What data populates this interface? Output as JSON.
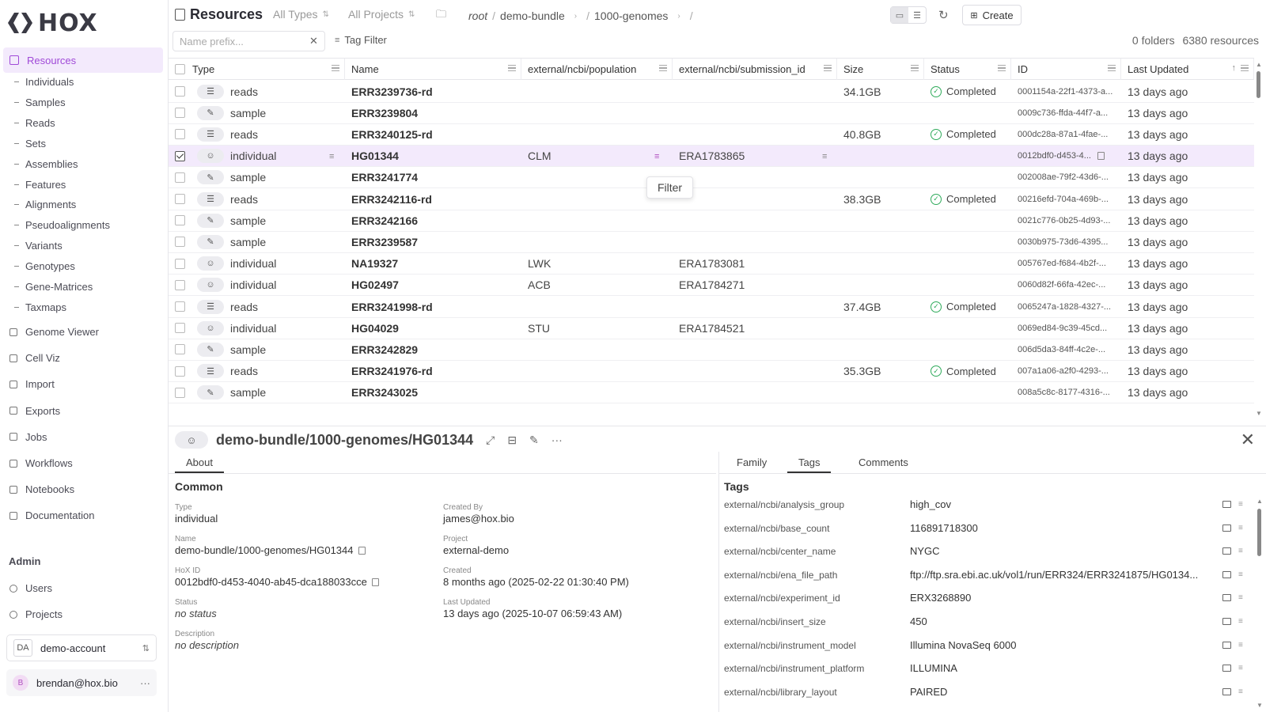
{
  "app": {
    "logo_text": "HOX"
  },
  "sidebar": {
    "active": "Resources",
    "sub_items": [
      "Individuals",
      "Samples",
      "Reads",
      "Sets",
      "Assemblies",
      "Features",
      "Alignments",
      "Pseudoalignments",
      "Variants",
      "Genotypes",
      "Gene-Matrices",
      "Taxmaps"
    ],
    "items": [
      "Genome Viewer",
      "Cell Viz",
      "Import",
      "Exports",
      "Jobs",
      "Workflows",
      "Notebooks",
      "Documentation"
    ],
    "admin_label": "Admin",
    "admin_items": [
      "Users",
      "Projects"
    ],
    "account": {
      "badge": "DA",
      "name": "demo-account"
    },
    "user": {
      "initial": "B",
      "email": "brendan@hox.bio",
      "more": "···"
    }
  },
  "header": {
    "title": "Resources",
    "types_filter": "All Types",
    "projects_filter": "All Projects",
    "breadcrumb": [
      "root",
      "demo-bundle",
      "1000-genomes"
    ],
    "create_label": "Create"
  },
  "filterbar": {
    "name_placeholder": "Name prefix...",
    "tag_filter_label": "Tag Filter",
    "folders_count": "0 folders",
    "resources_count": "6380 resources"
  },
  "table": {
    "columns": [
      "Type",
      "Name",
      "external/ncbi/population",
      "external/ncbi/submission_id",
      "Size",
      "Status",
      "ID",
      "Last Updated"
    ],
    "rows": [
      {
        "type": "reads",
        "name": "ERR3239736-rd",
        "population": "",
        "submission": "",
        "size": "34.1GB",
        "status": "Completed",
        "id": "0001154a-22f1-4373-a...",
        "updated": "13 days ago",
        "selected": false
      },
      {
        "type": "sample",
        "name": "ERR3239804",
        "population": "",
        "submission": "",
        "size": "",
        "status": "",
        "id": "0009c736-ffda-44f7-a...",
        "updated": "13 days ago",
        "selected": false
      },
      {
        "type": "reads",
        "name": "ERR3240125-rd",
        "population": "",
        "submission": "",
        "size": "40.8GB",
        "status": "Completed",
        "id": "000dc28a-87a1-4fae-...",
        "updated": "13 days ago",
        "selected": false
      },
      {
        "type": "individual",
        "name": "HG01344",
        "population": "CLM",
        "submission": "ERA1783865",
        "size": "",
        "status": "",
        "id": "0012bdf0-d453-4...",
        "updated": "13 days ago",
        "selected": true
      },
      {
        "type": "sample",
        "name": "ERR3241774",
        "population": "",
        "submission": "",
        "size": "",
        "status": "",
        "id": "002008ae-79f2-43d6-...",
        "updated": "13 days ago",
        "selected": false
      },
      {
        "type": "reads",
        "name": "ERR3242116-rd",
        "population": "",
        "submission": "",
        "size": "38.3GB",
        "status": "Completed",
        "id": "00216efd-704a-469b-...",
        "updated": "13 days ago",
        "selected": false
      },
      {
        "type": "sample",
        "name": "ERR3242166",
        "population": "",
        "submission": "",
        "size": "",
        "status": "",
        "id": "0021c776-0b25-4d93-...",
        "updated": "13 days ago",
        "selected": false
      },
      {
        "type": "sample",
        "name": "ERR3239587",
        "population": "",
        "submission": "",
        "size": "",
        "status": "",
        "id": "0030b975-73d6-4395...",
        "updated": "13 days ago",
        "selected": false
      },
      {
        "type": "individual",
        "name": "NA19327",
        "population": "LWK",
        "submission": "ERA1783081",
        "size": "",
        "status": "",
        "id": "005767ed-f684-4b2f-...",
        "updated": "13 days ago",
        "selected": false
      },
      {
        "type": "individual",
        "name": "HG02497",
        "population": "ACB",
        "submission": "ERA1784271",
        "size": "",
        "status": "",
        "id": "0060d82f-66fa-42ec-...",
        "updated": "13 days ago",
        "selected": false
      },
      {
        "type": "reads",
        "name": "ERR3241998-rd",
        "population": "",
        "submission": "",
        "size": "37.4GB",
        "status": "Completed",
        "id": "0065247a-1828-4327-...",
        "updated": "13 days ago",
        "selected": false
      },
      {
        "type": "individual",
        "name": "HG04029",
        "population": "STU",
        "submission": "ERA1784521",
        "size": "",
        "status": "",
        "id": "0069ed84-9c39-45cd...",
        "updated": "13 days ago",
        "selected": false
      },
      {
        "type": "sample",
        "name": "ERR3242829",
        "population": "",
        "submission": "",
        "size": "",
        "status": "",
        "id": "006d5da3-84ff-4c2e-...",
        "updated": "13 days ago",
        "selected": false
      },
      {
        "type": "reads",
        "name": "ERR3241976-rd",
        "population": "",
        "submission": "",
        "size": "35.3GB",
        "status": "Completed",
        "id": "007a1a06-a2f0-4293-...",
        "updated": "13 days ago",
        "selected": false
      },
      {
        "type": "sample",
        "name": "ERR3243025",
        "population": "",
        "submission": "",
        "size": "",
        "status": "",
        "id": "008a5c8c-8177-4316-...",
        "updated": "13 days ago",
        "selected": false
      }
    ],
    "tooltip": "Filter"
  },
  "detail": {
    "path": "demo-bundle/1000-genomes/HG01344",
    "more": "···",
    "left_tabs": [
      "About"
    ],
    "right_tabs": [
      "Family",
      "Tags",
      "Comments"
    ],
    "active_right_tab": "Tags",
    "common_title": "Common",
    "fields": {
      "type_label": "Type",
      "type": "individual",
      "created_by_label": "Created By",
      "created_by": "james@hox.bio",
      "name_label": "Name",
      "name": "demo-bundle/1000-genomes/HG01344",
      "project_label": "Project",
      "project": "external-demo",
      "hoxid_label": "HoX ID",
      "hoxid": "0012bdf0-d453-4040-ab45-dca188033cce",
      "created_label": "Created",
      "created": "8 months ago (2025-02-22 01:30:40 PM)",
      "status_label": "Status",
      "status": "no status",
      "updated_label": "Last Updated",
      "updated": "13 days ago (2025-10-07 06:59:43 AM)",
      "desc_label": "Description",
      "desc": "no description"
    },
    "tags_title": "Tags",
    "tags": [
      {
        "k": "external/ncbi/analysis_group",
        "v": "high_cov"
      },
      {
        "k": "external/ncbi/base_count",
        "v": "116891718300"
      },
      {
        "k": "external/ncbi/center_name",
        "v": "NYGC"
      },
      {
        "k": "external/ncbi/ena_file_path",
        "v": "ftp://ftp.sra.ebi.ac.uk/vol1/run/ERR324/ERR3241875/HG0134..."
      },
      {
        "k": "external/ncbi/experiment_id",
        "v": "ERX3268890"
      },
      {
        "k": "external/ncbi/insert_size",
        "v": "450"
      },
      {
        "k": "external/ncbi/instrument_model",
        "v": "Illumina NovaSeq 6000"
      },
      {
        "k": "external/ncbi/instrument_platform",
        "v": "ILLUMINA"
      },
      {
        "k": "external/ncbi/library_layout",
        "v": "PAIRED"
      }
    ]
  }
}
